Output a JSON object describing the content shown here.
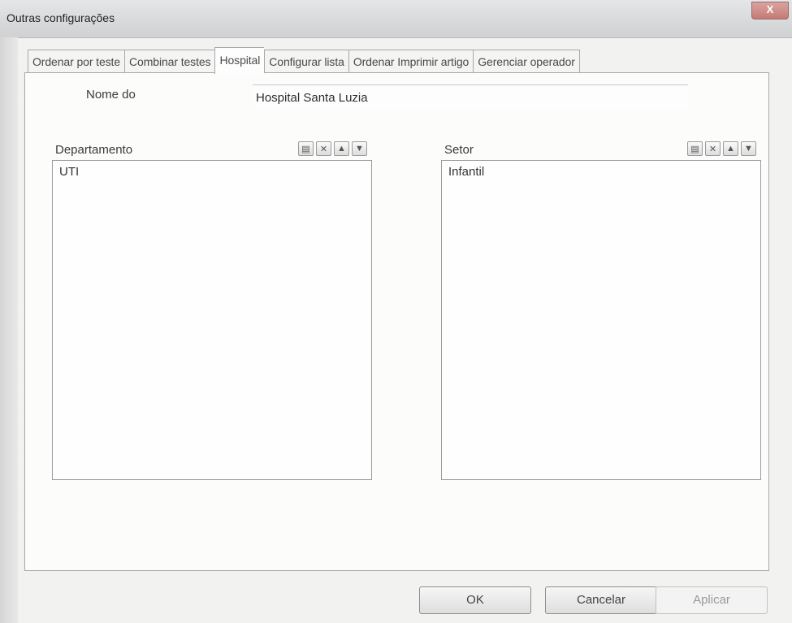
{
  "window": {
    "title": "Outras configurações",
    "close_label": "X"
  },
  "tabs": [
    {
      "label": "Ordenar por teste",
      "active": false
    },
    {
      "label": "Combinar testes",
      "active": false
    },
    {
      "label": "Hospital",
      "active": true
    },
    {
      "label": "Configurar lista",
      "active": false
    },
    {
      "label": "Ordenar Imprimir artigo",
      "active": false
    },
    {
      "label": "Gerenciar operador",
      "active": false
    }
  ],
  "hospital": {
    "name_label": "Nome do",
    "name_value": "Hospital Santa Luzia",
    "departamento": {
      "header": "Departamento",
      "items": [
        "UTI"
      ],
      "buttons": [
        "add-icon",
        "delete-icon",
        "up-arrow-icon",
        "down-arrow-icon"
      ]
    },
    "setor": {
      "header": "Setor",
      "items": [
        "Infantil"
      ],
      "buttons": [
        "add-icon",
        "delete-icon",
        "up-arrow-icon",
        "down-arrow-icon"
      ]
    }
  },
  "buttons": {
    "ok": "OK",
    "cancel": "Cancelar",
    "apply": "Aplicar",
    "apply_enabled": false
  }
}
